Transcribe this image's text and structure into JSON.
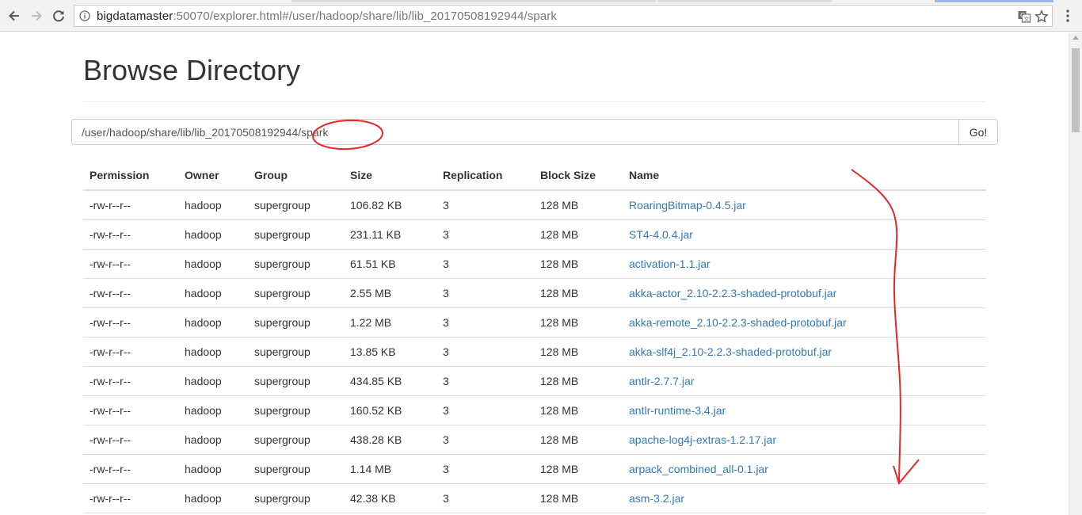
{
  "browser": {
    "url_host": "bigdatamaster",
    "url_rest": ":50070/explorer.html#/user/hadoop/share/lib/lib_20170508192944/spark",
    "back_icon": "back-arrow-icon",
    "forward_icon": "forward-arrow-icon",
    "reload_icon": "reload-icon",
    "info_icon": "info-icon",
    "translate_icon": "translate-icon",
    "bookmark_icon": "star-icon",
    "menu_icon": "kebab-menu-icon"
  },
  "page": {
    "title": "Browse Directory",
    "path_value": "/user/hadoop/share/lib/lib_20170508192944/spark",
    "go_label": "Go!"
  },
  "table": {
    "headers": [
      "Permission",
      "Owner",
      "Group",
      "Size",
      "Replication",
      "Block Size",
      "Name"
    ],
    "rows": [
      [
        "-rw-r--r--",
        "hadoop",
        "supergroup",
        "106.82 KB",
        "3",
        "128 MB",
        "RoaringBitmap-0.4.5.jar"
      ],
      [
        "-rw-r--r--",
        "hadoop",
        "supergroup",
        "231.11 KB",
        "3",
        "128 MB",
        "ST4-4.0.4.jar"
      ],
      [
        "-rw-r--r--",
        "hadoop",
        "supergroup",
        "61.51 KB",
        "3",
        "128 MB",
        "activation-1.1.jar"
      ],
      [
        "-rw-r--r--",
        "hadoop",
        "supergroup",
        "2.55 MB",
        "3",
        "128 MB",
        "akka-actor_2.10-2.2.3-shaded-protobuf.jar"
      ],
      [
        "-rw-r--r--",
        "hadoop",
        "supergroup",
        "1.22 MB",
        "3",
        "128 MB",
        "akka-remote_2.10-2.2.3-shaded-protobuf.jar"
      ],
      [
        "-rw-r--r--",
        "hadoop",
        "supergroup",
        "13.85 KB",
        "3",
        "128 MB",
        "akka-slf4j_2.10-2.2.3-shaded-protobuf.jar"
      ],
      [
        "-rw-r--r--",
        "hadoop",
        "supergroup",
        "434.85 KB",
        "3",
        "128 MB",
        "antlr-2.7.7.jar"
      ],
      [
        "-rw-r--r--",
        "hadoop",
        "supergroup",
        "160.52 KB",
        "3",
        "128 MB",
        "antlr-runtime-3.4.jar"
      ],
      [
        "-rw-r--r--",
        "hadoop",
        "supergroup",
        "438.28 KB",
        "3",
        "128 MB",
        "apache-log4j-extras-1.2.17.jar"
      ],
      [
        "-rw-r--r--",
        "hadoop",
        "supergroup",
        "1.14 MB",
        "3",
        "128 MB",
        "arpack_combined_all-0.1.jar"
      ],
      [
        "-rw-r--r--",
        "hadoop",
        "supergroup",
        "42.38 KB",
        "3",
        "128 MB",
        "asm-3.2.jar"
      ]
    ]
  },
  "colors": {
    "link": "#337ab7",
    "annotation": "#e8262a"
  }
}
